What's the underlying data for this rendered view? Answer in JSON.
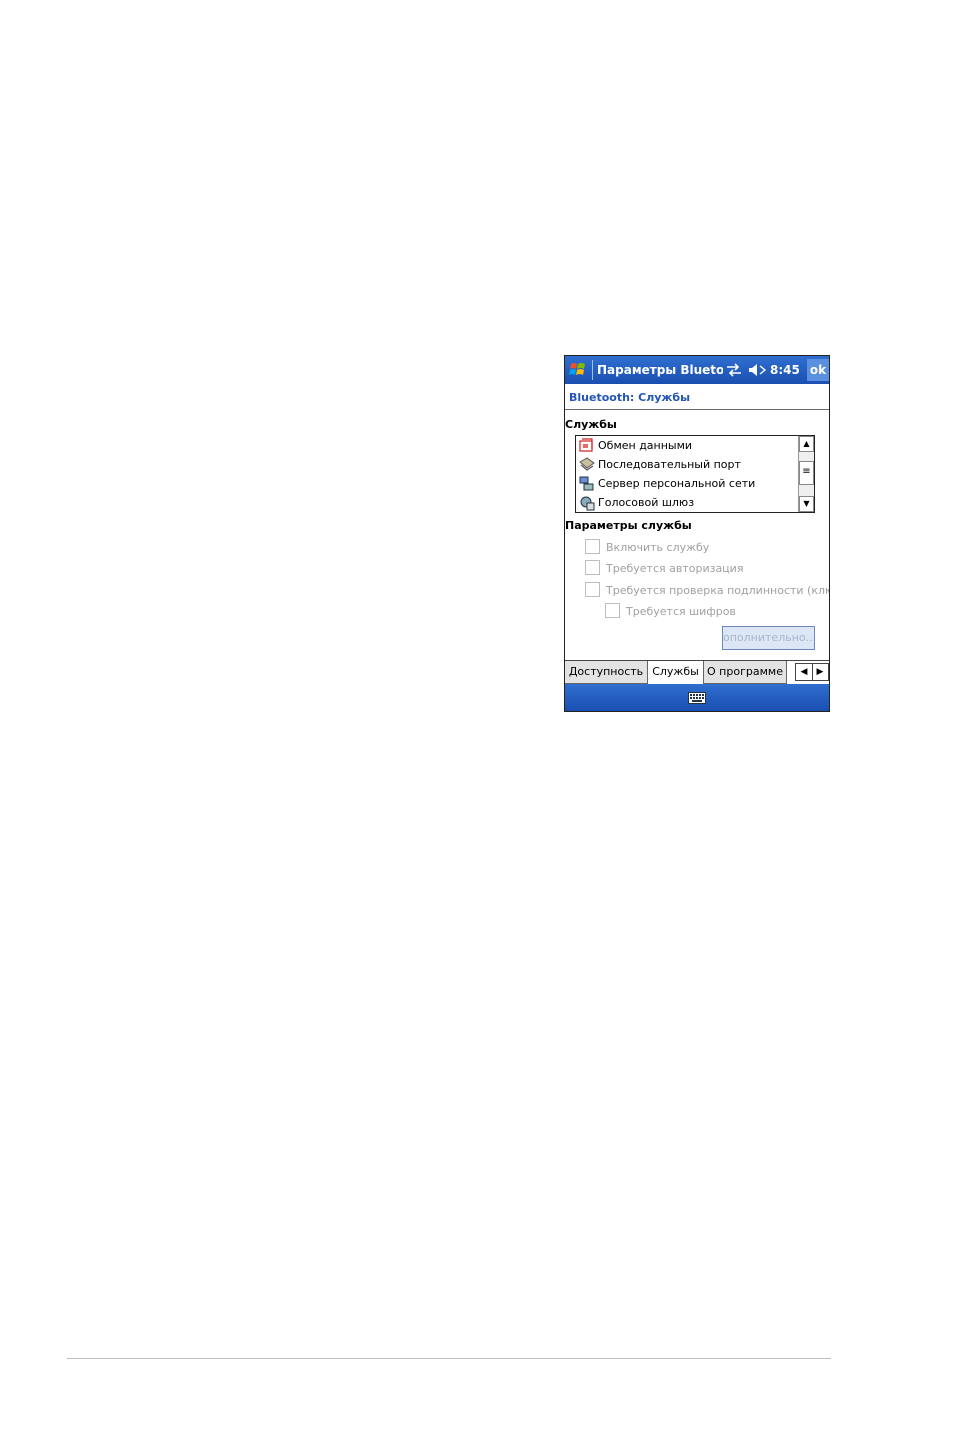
{
  "titlebar": {
    "title": "Параметры Blueto",
    "time": "8:45",
    "ok_label": "ok"
  },
  "header": {
    "title": "Bluetooth: Службы"
  },
  "services": {
    "label": "Службы",
    "items": [
      {
        "label": "Обмен данными",
        "icon": "data-exchange-icon"
      },
      {
        "label": "Последовательный порт",
        "icon": "serial-port-icon"
      },
      {
        "label": "Сервер персональной сети",
        "icon": "network-server-icon"
      },
      {
        "label": "Голосовой шлюз",
        "icon": "voice-gateway-icon"
      }
    ]
  },
  "service_params": {
    "label": "Параметры службы",
    "checkboxes": [
      {
        "label": "Включить службу",
        "checked": false
      },
      {
        "label": "Требуется авторизация",
        "checked": false
      },
      {
        "label": "Требуется проверка подлинности (клю",
        "checked": false
      },
      {
        "label": "Требуется шифров",
        "checked": false
      }
    ],
    "advanced_label": "ополнительно..."
  },
  "tabs": [
    {
      "label": "Доступность",
      "active": false
    },
    {
      "label": "Службы",
      "active": true
    },
    {
      "label": "О программе",
      "active": false
    }
  ],
  "tab_arrows": {
    "left": "◀",
    "right": "▶"
  },
  "scrollbar": {
    "up": "▲",
    "down": "▼",
    "thumb": "≡"
  },
  "colors": {
    "titlebar": "#1f58c0",
    "header_text": "#2455b8",
    "disabled_text": "#a0a0a0"
  }
}
